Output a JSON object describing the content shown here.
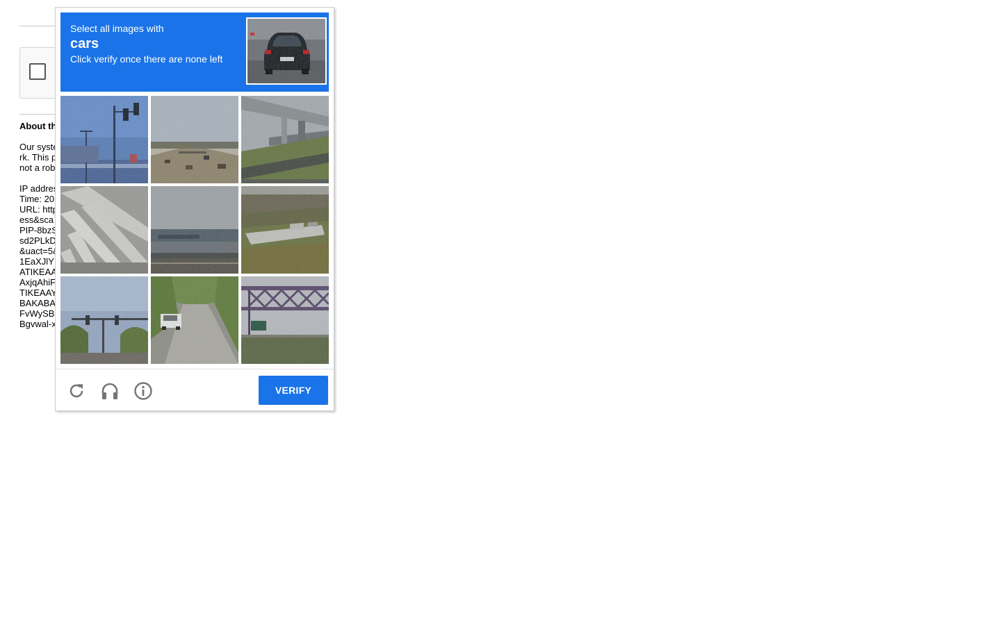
{
  "background_page": {
    "about_heading": "About th",
    "text_lines": [
      "Our syste",
      "rk. This p",
      "not a rob",
      "",
      "IP addres",
      "Time: 20",
      "URL: http",
      "ess&sca",
      "PIP-8bzS",
      "sd2PLkD",
      "&uact=5&",
      "1EaXJlY",
      "ATIKEAA",
      "AxjqAhiF",
      "TIKEAAY",
      "BAKABA",
      "FvWySB",
      "Bgvwal-x"
    ]
  },
  "challenge": {
    "instruction_top": "Select all images with",
    "keyword": "cars",
    "instruction_bottom": "Click verify once there are none left",
    "sample_image": "car-rear-view",
    "tiles": [
      {
        "scene": "traffic-lights-blue-sky"
      },
      {
        "scene": "highway-with-cars"
      },
      {
        "scene": "overpass-bridge"
      },
      {
        "scene": "crosswalk-stripes"
      },
      {
        "scene": "water-and-highway"
      },
      {
        "scene": "boat-on-grass"
      },
      {
        "scene": "traffic-lights-trees"
      },
      {
        "scene": "street-with-parked-car"
      },
      {
        "scene": "steel-truss-bridge-sign"
      }
    ],
    "icons": {
      "reload": "reload-icon",
      "audio": "headphones-icon",
      "info": "info-icon"
    },
    "verify_label": "VERIFY"
  },
  "colors": {
    "accent": "#1a73e8",
    "icon_gray": "#757575"
  }
}
